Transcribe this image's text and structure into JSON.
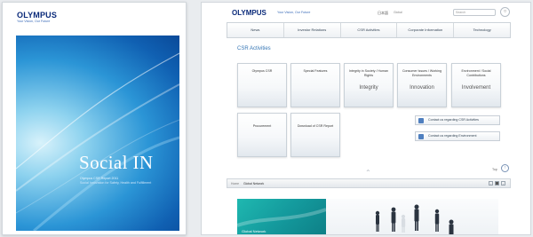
{
  "cover": {
    "logo": "OLYMPUS",
    "tagline": "Your Vision, Our Future",
    "title": "Social IN",
    "subtitle_1": "Olympus CSR Report 2011",
    "subtitle_2": "Social Innovation for Safety, Health and Fulfillment"
  },
  "site": {
    "logo": "OLYMPUS",
    "tagline": "Your Vision, Our Future",
    "language": "日本語",
    "language_sub": "Global",
    "search_placeholder": "Search",
    "search_icon": "search-icon",
    "nav": [
      "News",
      "Investor Relations",
      "CSR Activities",
      "Corporate Information",
      "Technology"
    ],
    "section_title": "CSR Activities",
    "tiles_row1": [
      {
        "label": "Olympus CSR",
        "word": ""
      },
      {
        "label": "Special Features",
        "word": ""
      },
      {
        "label": "Integrity in Society / Human Rights",
        "word": "Integrity"
      },
      {
        "label": "Consumer Issues / Working Environments",
        "word": "Innovation"
      },
      {
        "label": "Environment / Social Contributions",
        "word": "Involvement"
      }
    ],
    "tiles_row2": [
      {
        "label": "Procurement"
      },
      {
        "label": "Download of CSR Report"
      }
    ],
    "contacts": [
      "Contact us regarding CSR Activities",
      "Contact us regarding Environment"
    ],
    "page_top": "Top",
    "breadcrumb_home": "Home",
    "breadcrumb_current": "Global Network",
    "banner_label": "Global Network",
    "accent_color": "#3777b6",
    "brand_color": "#0a2a7a"
  }
}
